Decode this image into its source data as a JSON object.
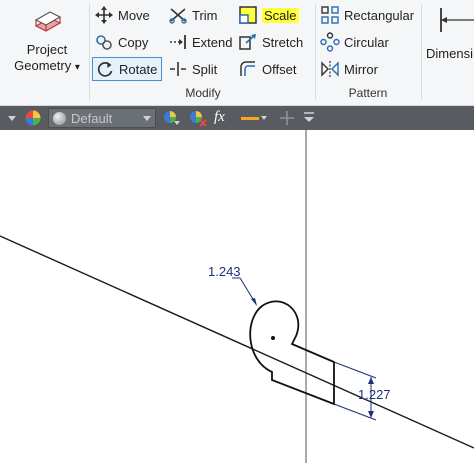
{
  "ribbon": {
    "project_geometry": {
      "line1": "Project",
      "line2": "Geometry",
      "arrow": "▾"
    },
    "modify": {
      "move": "Move",
      "copy": "Copy",
      "rotate": "Rotate",
      "trim": "Trim",
      "extend": "Extend",
      "split": "Split",
      "scale": "Scale",
      "stretch": "Stretch",
      "offset": "Offset",
      "group_label": "Modify"
    },
    "pattern": {
      "rectangular": "Rectangular",
      "circular": "Circular",
      "mirror": "Mirror",
      "group_label": "Pattern"
    },
    "dimension": "Dimensi"
  },
  "toolbar": {
    "appearance_value": "Default",
    "function_symbol": "fx"
  },
  "sketch": {
    "dim_radius": "1.243",
    "dim_height": "1.227"
  },
  "colors": {
    "highlight": "#ffff3c",
    "toolbar_bg": "#585c61",
    "dimension": "#1f2f7a"
  }
}
